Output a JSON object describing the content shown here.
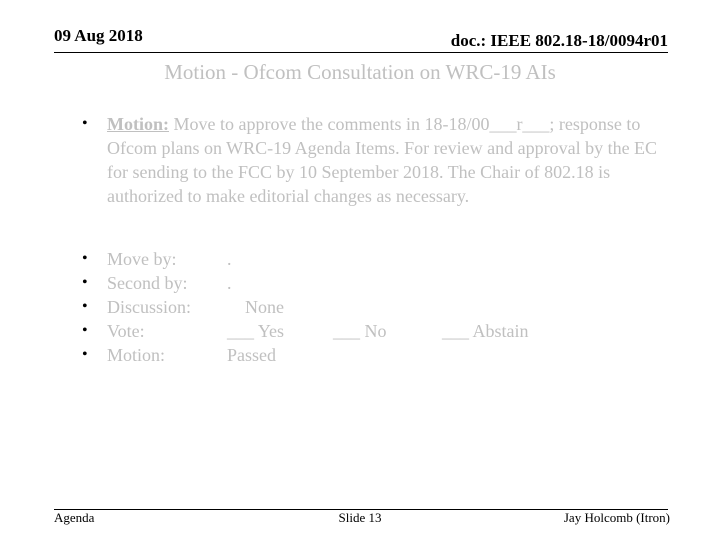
{
  "header": {
    "date": "09 Aug 2018",
    "doc_id": "doc.: IEEE 802.18-18/0094r01"
  },
  "title": "Motion - Ofcom Consultation on WRC-19 AIs",
  "motion": {
    "label": "Motion:",
    "text": " Move to approve the comments in 18-18/00___r___; response to Ofcom plans on WRC-19 Agenda Items. For review and approval by the EC for sending to the FCC by 10 September 2018. The Chair of 802.18 is authorized to make editorial changes as necessary."
  },
  "items": [
    {
      "label": "Move by:",
      "value": "."
    },
    {
      "label": "Second by:",
      "value": "."
    },
    {
      "label": "Discussion:",
      "value": "None"
    },
    {
      "label": "Vote:",
      "yes": "___ Yes",
      "no": "___ No",
      "abstain": "___ Abstain"
    },
    {
      "label": "Motion:",
      "value": "Passed"
    }
  ],
  "bullet_glyph": "•",
  "footer": {
    "left": "Agenda",
    "center": "Slide 13",
    "right": "Jay Holcomb (Itron)"
  },
  "colors": {
    "title": "#c0c0c0",
    "body_text": "#c0c0c0",
    "header_text": "#000000"
  }
}
